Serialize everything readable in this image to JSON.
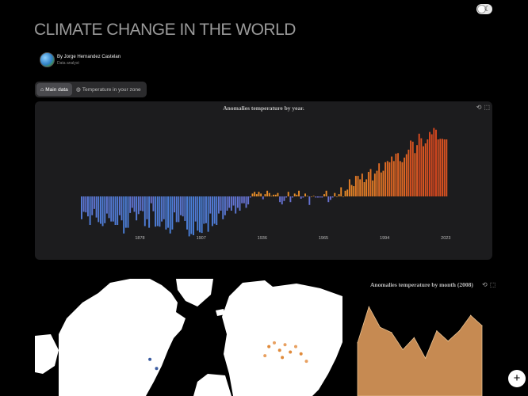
{
  "header": {
    "title": "CLIMATE CHANGE IN THE WORLD",
    "author_name": "By Jorge Hernandez Castelan",
    "author_role": "Data analyst"
  },
  "tabs": [
    {
      "label": "Main data",
      "icon": "home-icon",
      "active": true
    },
    {
      "label": "Temperature in your zone",
      "icon": "globe-icon",
      "active": false
    }
  ],
  "panels": {
    "yearly_title": "Anomalies temperature by year.",
    "monthly_title": "Anomalies temperature by month (2008)"
  },
  "chart_data": [
    {
      "type": "bar",
      "title": "Anomalies temperature by year.",
      "xlabel": "",
      "ylabel": "",
      "x_tick_labels": [
        "1878",
        "1907",
        "1936",
        "1965",
        "1994",
        "2023"
      ],
      "x_range": [
        1850,
        2024
      ],
      "grid": false,
      "legend": "none",
      "color_scale": [
        "#6f6fd0",
        "#4a7fd8",
        "#e8912a",
        "#d8451f"
      ],
      "values": [
        -0.4,
        -0.27,
        -0.28,
        -0.35,
        -0.5,
        -0.33,
        -0.22,
        -0.37,
        -0.45,
        -0.48,
        -0.52,
        -0.47,
        -0.3,
        -0.38,
        -0.44,
        -0.44,
        -0.5,
        -0.5,
        -0.33,
        -0.42,
        -0.65,
        -0.55,
        -0.55,
        -0.29,
        -0.2,
        -0.27,
        -0.42,
        -0.31,
        -0.25,
        -0.26,
        -0.52,
        -0.4,
        -0.55,
        -0.12,
        -0.26,
        -0.53,
        -0.52,
        -0.53,
        -0.44,
        -0.4,
        -0.58,
        -0.55,
        -0.65,
        -0.58,
        -0.28,
        -0.45,
        -0.45,
        -0.33,
        -0.35,
        -0.43,
        -0.58,
        -0.7,
        -0.66,
        -0.68,
        -0.44,
        -0.6,
        -0.63,
        -0.64,
        -0.48,
        -0.47,
        -0.62,
        -0.3,
        -0.52,
        -0.48,
        -0.5,
        -0.3,
        -0.25,
        -0.4,
        -0.33,
        -0.25,
        -0.2,
        -0.25,
        -0.16,
        -0.3,
        -0.2,
        -0.25,
        -0.12,
        -0.12,
        -0.2,
        -0.14,
        -0.02,
        0.05,
        0.08,
        0.04,
        0.08,
        0.05,
        -0.05,
        0.04,
        0.1,
        0.06,
        0.01,
        0.03,
        0.03,
        0.06,
        -0.1,
        -0.14,
        -0.08,
        -0.02,
        0.08,
        -0.1,
        -0.02,
        0.05,
        0.03,
        0.1,
        -0.04,
        -0.02,
        0.05,
        0.01,
        -0.15,
        0.0,
        0.01,
        -0.02,
        -0.02,
        -0.02,
        -0.02,
        0.04,
        0.1,
        -0.1,
        -0.06,
        -0.02,
        0.06,
        0.0,
        0.04,
        0.16,
        0.0,
        0.1,
        0.12,
        0.3,
        0.2,
        0.18,
        0.36,
        0.36,
        0.3,
        0.4,
        0.25,
        0.3,
        0.43,
        0.48,
        0.28,
        0.4,
        0.45,
        0.58,
        0.42,
        0.45,
        0.6,
        0.62,
        0.6,
        0.7,
        0.62,
        0.75,
        0.76,
        0.62,
        0.6,
        0.68,
        0.74,
        0.82,
        0.98,
        0.96,
        0.76,
        0.9,
        1.1,
        1.02,
        0.88,
        0.93,
        1.0,
        1.13,
        1.09,
        1.2,
        1.17,
        1.0,
        1.01,
        1.01,
        1.0,
        1.0
      ]
    },
    {
      "type": "area",
      "title": "Anomalies temperature by month (2008)",
      "xlabel": "",
      "ylabel": "",
      "grid": false,
      "legend": "none",
      "color": "#c68a52",
      "values": [
        0.31,
        0.52,
        0.4,
        0.37,
        0.27,
        0.34,
        0.22,
        0.38,
        0.32,
        0.38,
        0.47,
        0.41
      ]
    }
  ],
  "map": {
    "label": "world-map",
    "points": [
      {
        "lon": -84,
        "lat": 40,
        "color": "#3a5ba0"
      },
      {
        "lon": -79,
        "lat": 35,
        "color": "#3a5ba0"
      },
      {
        "lon": 5,
        "lat": 47,
        "color": "#e08a3a"
      },
      {
        "lon": 9,
        "lat": 49,
        "color": "#e8a060"
      },
      {
        "lon": 13,
        "lat": 45,
        "color": "#e08a3a"
      },
      {
        "lon": 17,
        "lat": 48,
        "color": "#e8a060"
      },
      {
        "lon": 21,
        "lat": 44,
        "color": "#e08a3a"
      },
      {
        "lon": 25,
        "lat": 47,
        "color": "#e8a060"
      },
      {
        "lon": 29,
        "lat": 43,
        "color": "#e08a3a"
      },
      {
        "lon": 2,
        "lat": 42,
        "color": "#e8a060"
      },
      {
        "lon": 15,
        "lat": 41,
        "color": "#e08a3a"
      },
      {
        "lon": 33,
        "lat": 39,
        "color": "#e8a060"
      }
    ]
  },
  "fab": "+"
}
